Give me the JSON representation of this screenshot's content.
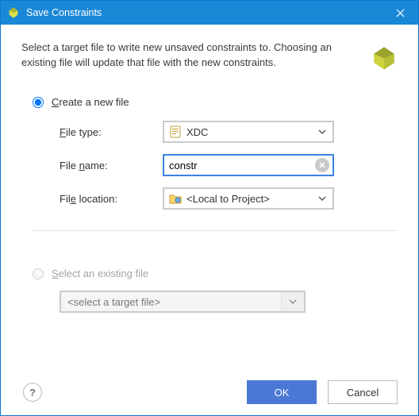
{
  "title": "Save Constraints",
  "description": "Select a target file to write new unsaved constraints to. Choosing an existing file will update that file with the new constraints.",
  "option_create": {
    "label": "Create a new file",
    "selected": true
  },
  "option_existing": {
    "label": "Select an existing file",
    "selected": false
  },
  "file_type": {
    "label": "File type:",
    "value": "XDC"
  },
  "file_name": {
    "label": "File name:",
    "value": "constr"
  },
  "file_location": {
    "label": "File location:",
    "value": "<Local to Project>"
  },
  "existing_file": {
    "placeholder": "<select a target file>"
  },
  "buttons": {
    "ok": "OK",
    "cancel": "Cancel"
  },
  "help": "?",
  "colors": {
    "accent": "#1b88d7",
    "primary_btn": "#4a78d4"
  }
}
